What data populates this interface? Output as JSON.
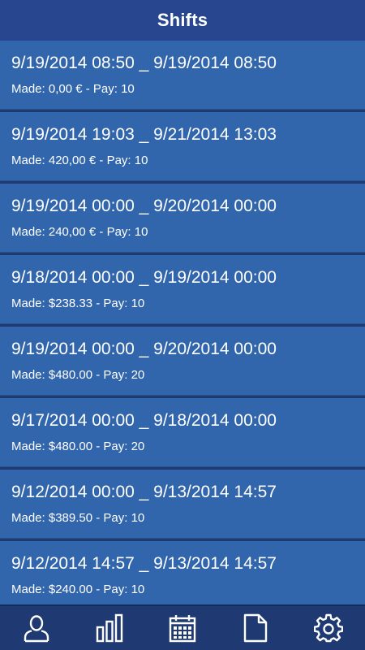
{
  "header": {
    "title": "Shifts"
  },
  "shifts": [
    {
      "range": "9/19/2014 08:50 _ 9/19/2014 08:50",
      "detail": "Made: 0,00 € - Pay: 10"
    },
    {
      "range": "9/19/2014 19:03 _ 9/21/2014 13:03",
      "detail": "Made: 420,00 € - Pay: 10"
    },
    {
      "range": "9/19/2014 00:00 _ 9/20/2014 00:00",
      "detail": "Made: 240,00 € - Pay: 10"
    },
    {
      "range": "9/18/2014 00:00 _ 9/19/2014 00:00",
      "detail": "Made: $238.33 - Pay: 10"
    },
    {
      "range": "9/19/2014 00:00 _ 9/20/2014 00:00",
      "detail": "Made: $480.00 - Pay: 20"
    },
    {
      "range": "9/17/2014 00:00 _ 9/18/2014 00:00",
      "detail": "Made: $480.00 - Pay: 20"
    },
    {
      "range": "9/12/2014 00:00 _ 9/13/2014 14:57",
      "detail": "Made: $389.50 - Pay: 10"
    },
    {
      "range": "9/12/2014 14:57 _ 9/13/2014 14:57",
      "detail": "Made: $240.00 - Pay: 10"
    }
  ],
  "tabbar": {
    "icons": [
      "person-icon",
      "bar-chart-icon",
      "calendar-icon",
      "document-icon",
      "gear-icon"
    ]
  },
  "colors": {
    "header": "#27468f",
    "row": "#3166ad",
    "background": "#1f3a72",
    "text": "#ffffff"
  }
}
